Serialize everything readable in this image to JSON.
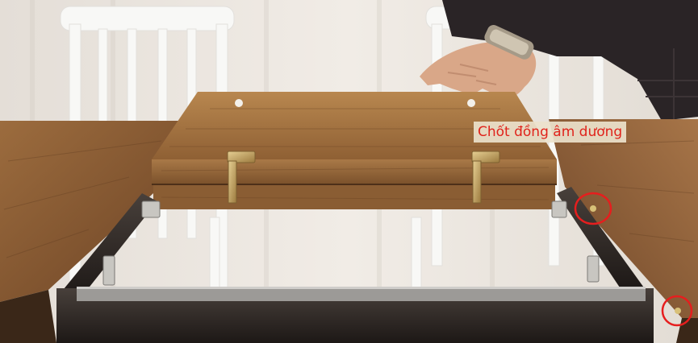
{
  "annotation": {
    "label": "Chốt đồng âm dương",
    "label_color": "#e0231b",
    "marker_color": "#e61e1e"
  },
  "scene": {
    "subject": "extendable wooden table with folding leaf, brass hinges and dowel pins",
    "palette": {
      "curtain": "#ece7e1",
      "wood_light": "#b3814f",
      "wood_dark": "#6f4527",
      "metal_frame": "#2b2522",
      "brass": "#c9a968"
    }
  }
}
